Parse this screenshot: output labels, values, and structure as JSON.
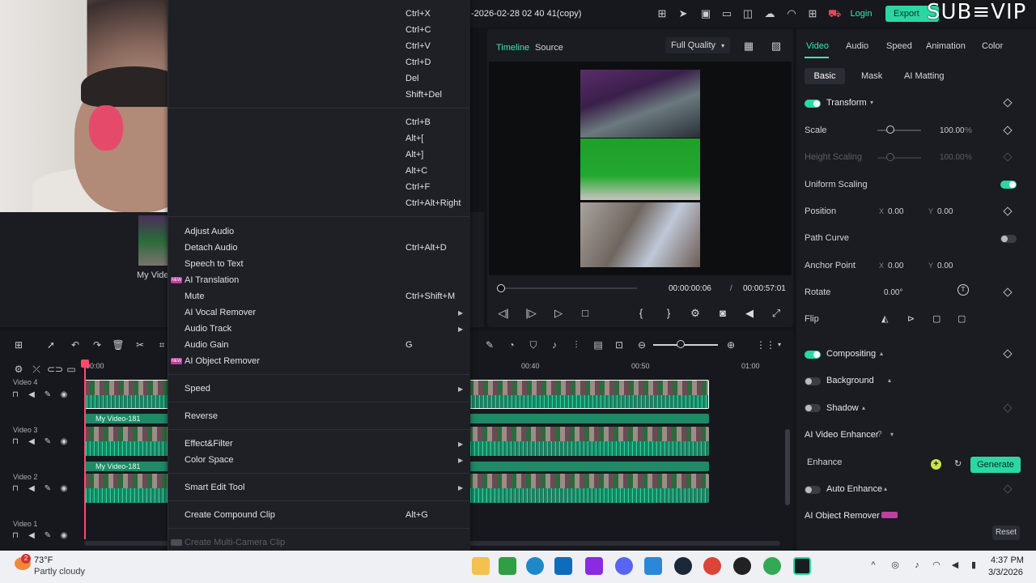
{
  "titlebar": {
    "project_title": "-2026-02-28 02 40 41(copy)",
    "login_label": "Login",
    "export_label": "Export",
    "watermark": "SUB≡VIP"
  },
  "player": {
    "tab_timeline": "Timeline",
    "tab_source": "Source",
    "quality": "Full Quality",
    "time_current": "00:00:00:06",
    "time_separator": "/",
    "time_total": "00:00:57:01"
  },
  "props": {
    "tabs": [
      "Video",
      "Audio",
      "Speed",
      "Animation",
      "Color"
    ],
    "subtabs": [
      "Basic",
      "Mask",
      "AI Matting"
    ],
    "transform": "Transform",
    "scale_label": "Scale",
    "scale_value": "100.00",
    "scale_unit": "%",
    "height_scaling_label": "Height Scaling",
    "height_scaling_value": "100.00",
    "height_scaling_unit": "%",
    "uniform_scaling_label": "Uniform Scaling",
    "position_label": "Position",
    "position_x_label": "X",
    "position_x": "0.00",
    "position_y_label": "Y",
    "position_y": "0.00",
    "path_curve_label": "Path Curve",
    "anchor_point_label": "Anchor Point",
    "anchor_x_label": "X",
    "anchor_x": "0.00",
    "anchor_y_label": "Y",
    "anchor_y": "0.00",
    "rotate_label": "Rotate",
    "rotate_value": "0.00°",
    "flip_label": "Flip",
    "compositing": "Compositing",
    "background": "Background",
    "shadow": "Shadow",
    "ai_video_enhancer": "AI Video Enhancer",
    "enhance_label": "Enhance",
    "generate_label": "Generate",
    "auto_enhance": "Auto Enhance",
    "ai_object_remover": "AI Object Remover",
    "reset_label": "Reset"
  },
  "media": {
    "name": "My Vide"
  },
  "timeline": {
    "ticks": [
      "00:00",
      "00:40",
      "00:50",
      "01:00"
    ],
    "tracks": [
      {
        "name": "Video 4"
      },
      {
        "name": "Video 3"
      },
      {
        "name": "Video 2"
      },
      {
        "name": "Video 1"
      }
    ],
    "clip_label": "My Video-181"
  },
  "context_menu": {
    "top_shortcuts": [
      "Ctrl+X",
      "Ctrl+C",
      "Ctrl+V",
      "Ctrl+D",
      "Del",
      "Shift+Del"
    ],
    "mid_shortcuts": [
      "Ctrl+B",
      "Alt+[",
      "Alt+]",
      "Alt+C",
      "Ctrl+F",
      "Ctrl+Alt+Right"
    ],
    "items": [
      {
        "label": "Adjust Audio",
        "shortcut": ""
      },
      {
        "label": "Detach Audio",
        "shortcut": "Ctrl+Alt+D"
      },
      {
        "label": "Speech to Text",
        "shortcut": ""
      },
      {
        "label": "AI Translation",
        "shortcut": ""
      },
      {
        "label": "Mute",
        "shortcut": "Ctrl+Shift+M"
      },
      {
        "label": "AI Vocal Remover",
        "shortcut": ""
      },
      {
        "label": "Audio Track",
        "shortcut": ""
      },
      {
        "label": "Audio Gain",
        "shortcut": "G"
      },
      {
        "label": "AI Object Remover",
        "shortcut": ""
      },
      {
        "label": "Speed",
        "shortcut": ""
      },
      {
        "label": "Reverse",
        "shortcut": ""
      },
      {
        "label": "Effect&Filter",
        "shortcut": ""
      },
      {
        "label": "Color Space",
        "shortcut": ""
      },
      {
        "label": "Smart Edit Tool",
        "shortcut": ""
      },
      {
        "label": "Create Compound Clip",
        "shortcut": "Alt+G"
      },
      {
        "label": "Create Multi-Camera Clip",
        "shortcut": ""
      }
    ],
    "new_badge": "NEW"
  },
  "taskbar": {
    "weather_badge": "2",
    "weather_temp": "73°F",
    "weather_desc": "Partly cloudy",
    "time": "4:37 PM",
    "date": "3/3/2026"
  },
  "colors": {
    "accent": "#2ad7a5",
    "playhead": "#ff4a6b",
    "new_badge": "#c040a0"
  }
}
